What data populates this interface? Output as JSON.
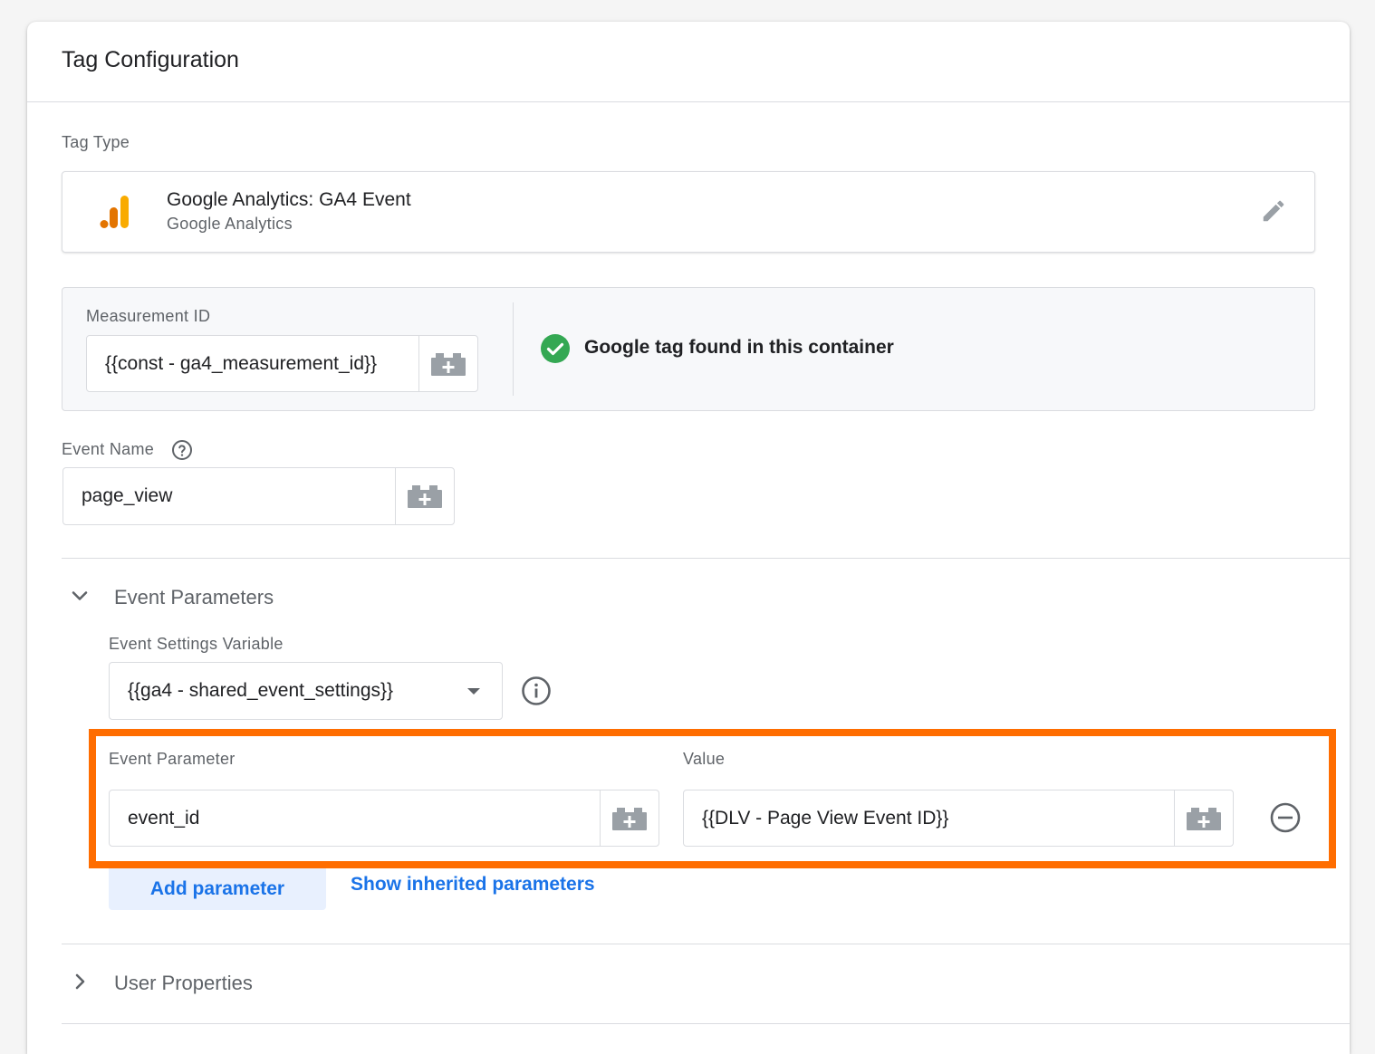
{
  "card": {
    "title": "Tag Configuration"
  },
  "tag_type": {
    "label": "Tag Type",
    "name": "Google Analytics: GA4 Event",
    "provider": "Google Analytics",
    "icon": "ga-analytics-logo-icon",
    "edit_icon": "pencil-icon"
  },
  "measurement": {
    "label": "Measurement ID",
    "value": "{{const - ga4_measurement_id}}",
    "status_text": "Google tag found in this container",
    "status_color": "#34a853"
  },
  "event_name": {
    "label": "Event Name",
    "help_icon": "help-circle-icon",
    "value": "page_view"
  },
  "event_parameters": {
    "title": "Event Parameters",
    "expanded": true,
    "settings_variable_label": "Event Settings Variable",
    "settings_variable_value": "{{ga4 - shared_event_settings}}",
    "info_icon": "info-icon",
    "param_column_label": "Event Parameter",
    "value_column_label": "Value",
    "rows": [
      {
        "parameter": "event_id",
        "value": "{{DLV - Page View Event ID}}"
      }
    ],
    "add_parameter_label": "Add parameter",
    "show_inherited_label": "Show inherited parameters"
  },
  "user_properties": {
    "title": "User Properties",
    "expanded": false
  },
  "colors": {
    "highlight": "#ff6d00",
    "link": "#1a73e8",
    "ga_orange": "#f9ab00",
    "ga_dark_orange": "#e37400"
  }
}
